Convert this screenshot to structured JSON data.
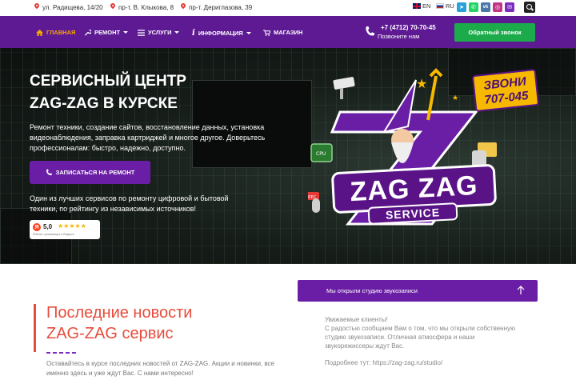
{
  "topbar": {
    "addresses": [
      "ул. Радищева, 14/20",
      "пр-т. В. Клыкова, 8",
      "пр-т. Дериглазова, 39"
    ],
    "languages": [
      {
        "code": "EN",
        "flag": "uk-flag"
      },
      {
        "code": "RU",
        "flag": "ru-flag"
      }
    ],
    "socials": [
      {
        "name": "telegram-icon",
        "color": "#2aa1da"
      },
      {
        "name": "whatsapp-icon",
        "color": "#25d366"
      },
      {
        "name": "vk-icon",
        "color": "#4a76a8"
      },
      {
        "name": "instagram-icon",
        "color": "#c13584"
      },
      {
        "name": "email-icon",
        "color": "#7b2cbf"
      }
    ]
  },
  "nav": {
    "items": [
      {
        "label": "ГЛАВНАЯ",
        "icon": "home-icon",
        "active": true
      },
      {
        "label": "РЕМОНТ",
        "icon": "wrench-icon",
        "dropdown": true
      },
      {
        "label": "УСЛУГИ",
        "icon": "list-icon",
        "dropdown": true
      },
      {
        "label": "ИНФОРМАЦИЯ",
        "icon": "info-icon",
        "dropdown": true
      },
      {
        "label": "МАГАЗИН",
        "icon": "cart-icon"
      }
    ],
    "phone": "+7 (4712) 70-70-45",
    "phone_note": "Позвоните нам",
    "callback_label": "Обратный звонок"
  },
  "hero": {
    "title_line1": "СЕРВИСНЫЙ ЦЕНТР",
    "title_line2": "ZAG-ZAG В КУРСКЕ",
    "description": "Ремонт техники, создание сайтов, восстановление данных, установка видеонаблюдения, заправка картриджей и многое другое. Доверьтесь профессионалам: быстро, надежно, доступно.",
    "cta_label": "ЗАПИСАТЬСЯ НА РЕМОНТ",
    "note": "Один из лучших сервисов по ремонту цифровой и бытовой техники, по рейтингу из независимых источников!",
    "rating": {
      "value": "5,0",
      "stars": "★★★★★",
      "caption": "Рейтинг организации в Яндексе"
    },
    "logo": {
      "badge_line1": "ЗВОНИ",
      "badge_line2": "707-045",
      "brand": "ZAG ZAG",
      "sub": "SERVICE"
    }
  },
  "news": {
    "title_line1": "Последние новости",
    "title_line2": "ZAG-ZAG сервис",
    "description": "Оставайтесь в курсе последних новостей от ZAG-ZAG. Акции и новинки, все именно здесь и уже ждут Вас. С нами интересно!",
    "accordion": {
      "title": "Мы открыли студию звукозаписи",
      "greeting": "Уважаемые клиенты!",
      "body": "С радостью сообщаем Вам о том, что мы открыли собственную студию звукозаписи. Отличная атмосфера и наши звукорежиссеры ждут Вас.",
      "link_text": "Подробнее тут: https://zag-zag.ru/studio/"
    }
  },
  "colors": {
    "brand_purple": "#5e1a93",
    "accent_orange": "#f7a600",
    "green": "#1bab4a",
    "news_red": "#e74c3c"
  }
}
